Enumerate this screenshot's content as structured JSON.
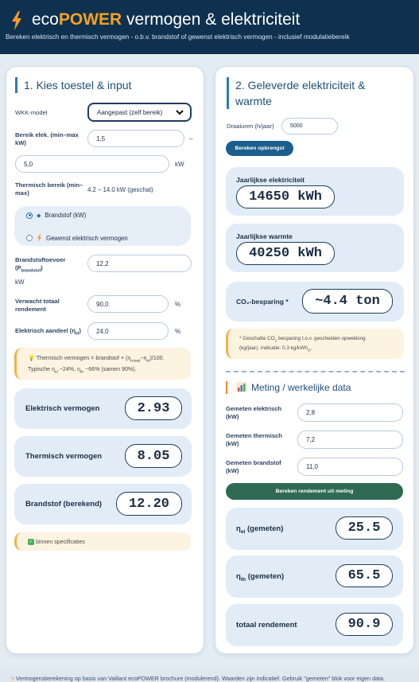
{
  "header": {
    "title_pre": "eco",
    "title_brand": "POWER",
    "title_post": " vermogen & elektriciteit",
    "subtitle": "Bereken elektrisch en thermisch vermogen - o.b.v. brandstof of gewenst elektrisch vermogen - inclusief modulatiebereik"
  },
  "left": {
    "title": "1. Kies toestel & input",
    "model_label": "WKK-model",
    "model_value": "Aangepast (zelf bereik)",
    "elec_range_label": "Bereik elek. (min–max kW)",
    "elec_min": "1,5",
    "elec_dash": "–",
    "elec_max": "5,0",
    "elec_unit": "kW",
    "therm_range_label": "Thermisch bereik (min–max)",
    "therm_range_value": "4.2 – 14.0 kW (geschat)",
    "radio_fuel": "Brandstof (kW)",
    "radio_elec": "Gewenst elektrisch vermogen",
    "fuel_label_a": "Brandstoftoevoer",
    "fuel_label_b": "(P",
    "fuel_label_sub": "brandstof",
    "fuel_label_c": ")",
    "fuel_value": "12,2",
    "fuel_unit": "kW",
    "total_eff_label": "Verwacht totaal rendement",
    "total_eff_value": "90,0",
    "total_eff_unit": "%",
    "elec_share_label": "Elektrisch aandeel (η",
    "elec_share_sub": "el",
    "elec_share_close": ")",
    "elec_share_value": "24,0",
    "elec_share_unit": "%",
    "note_line1": "Thermisch vermogen = brandstof × (η",
    "note_sub1": "totaal",
    "note_mid1": "−η",
    "note_sub2": "el",
    "note_end1": ")/100.",
    "note_line2a": "Typische η",
    "note_sub3": "el",
    "note_line2b": " ~24%, η",
    "note_sub4": "th",
    "note_line2c": " ~66% (samen 90%).",
    "results": [
      {
        "label": "Elektrisch vermogen",
        "value": "2.93"
      },
      {
        "label": "Thermisch vermogen",
        "value": "8.05"
      },
      {
        "label": "Brandstof (berekend)",
        "value": "12.20"
      }
    ],
    "status": "binnen specificaties"
  },
  "right": {
    "title_line1": "2. Geleverde elektriciteit &",
    "title_line2": "warmte",
    "hours_label": "Draaiuren (h/jaar)",
    "hours_value": "5000",
    "calc_button": "Bereken opbrengst",
    "annual_elec_label": "Jaarlijkse elektriciteit",
    "annual_elec_value": "14650 kWh",
    "annual_heat_label": "Jaarlijkse warmte",
    "annual_heat_value": "40250 kWh",
    "co2_label": "CO₂-besparing *",
    "co2_value": "~4.4 ton",
    "co2_note_a": "* Geschatte CO",
    "co2_note_sub": "2",
    "co2_note_b": " besparing t.o.v. gescheiden opwekking",
    "co2_note_c": "(kg/jaar). indicatie: 0,3 kg/kWh",
    "co2_note_sub2": "el",
    "co2_note_d": ".",
    "measure_title": "Meting / werkelijke data",
    "measured_elec_label": "Gemeten elektrisch (kW)",
    "measured_elec_value": "2,8",
    "measured_therm_label": "Gemeten thermisch (kW)",
    "measured_therm_value": "7,2",
    "measured_fuel_label": "Gemeten brandstof (kW)",
    "measured_fuel_value": "11,0",
    "measure_button": "Bereken rendement uit meting",
    "eta_el_label": "η",
    "eta_el_sub": "el",
    "eta_el_rest": " (gemeten)",
    "eta_el_value": "25.5",
    "eta_th_label": "η",
    "eta_th_sub": "th",
    "eta_th_rest": " (gemeten)",
    "eta_th_value": "65.5",
    "total_label": "totaal rendement",
    "total_value": "90.9"
  },
  "footer": {
    "text": "Vermogensberekening op basis van Vaillant ecoPOWER brochure (modulerend). Waarden zijn indicatief. Gebruik \"gemeten\" blok voor eigen data."
  },
  "colors": {
    "header_bg": "#0f3150",
    "brand_accent": "#f6a21e",
    "primary_button": "#1c5f8c",
    "measure_button": "#2f6b52",
    "result_bg": "#e1ecf7",
    "note_bg": "#fdf3e1"
  }
}
